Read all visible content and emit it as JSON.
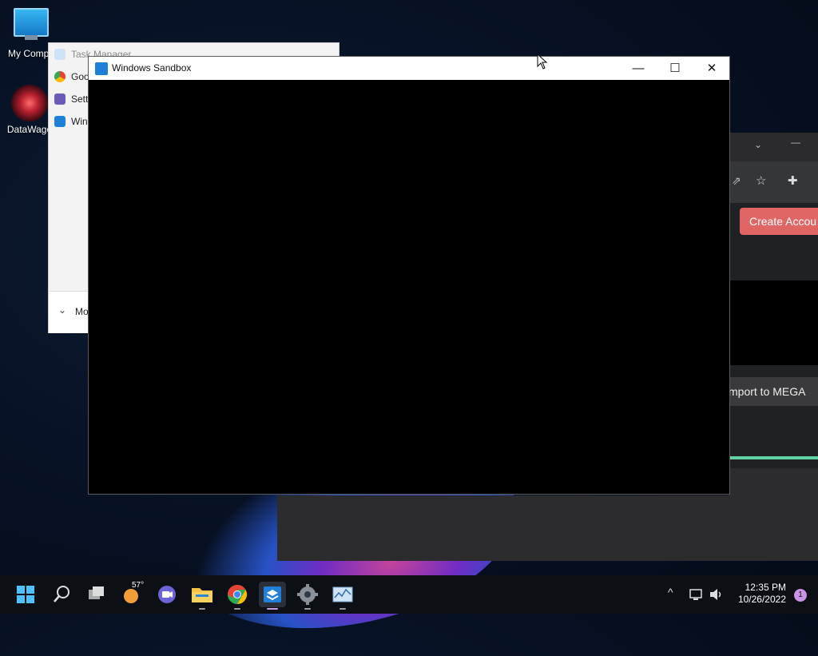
{
  "desktop": {
    "icons": [
      {
        "label": "My Compu"
      },
      {
        "label": "DataWago"
      }
    ]
  },
  "task_manager": {
    "title": "Task Manager",
    "rows": [
      "Goo",
      "Setti",
      "Win"
    ],
    "more_label": "Mo"
  },
  "sandbox": {
    "title": "Windows Sandbox",
    "minimize": "—",
    "maximize": "☐",
    "close": "✕"
  },
  "browser": {
    "create_label": "Create Accou",
    "import_label": "mport to MEGA"
  },
  "taskbar": {
    "weather_temp": "57°",
    "time": "12:35 PM",
    "date": "10/26/2022",
    "notification_count": "1"
  },
  "colors": {
    "accent": "#1f7fd9",
    "create_button": "#e06666",
    "progress_green": "#5fd3a4",
    "notification": "#c993e6"
  }
}
